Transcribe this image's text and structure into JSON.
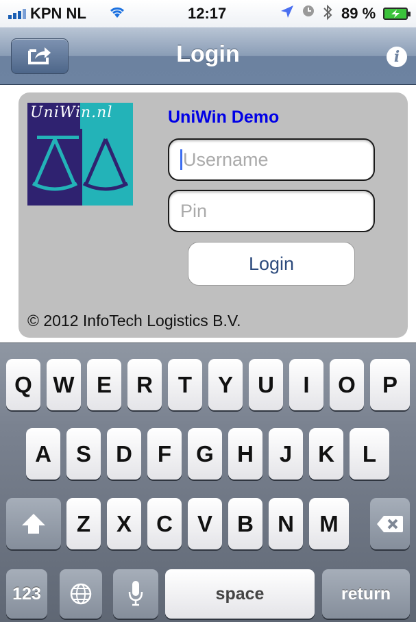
{
  "status_bar": {
    "carrier": "KPN NL",
    "time": "12:17",
    "battery": "89 %"
  },
  "nav_bar": {
    "title": "Login",
    "info_label": "i"
  },
  "login_panel": {
    "logo_text": "UniWin.nl",
    "app_title": "UniWin Demo",
    "username_placeholder": "Username",
    "pin_placeholder": "Pin",
    "login_label": "Login",
    "copyright": "© 2012 InfoTech Logistics B.V."
  },
  "keyboard": {
    "row1": [
      "Q",
      "W",
      "E",
      "R",
      "T",
      "Y",
      "U",
      "I",
      "O",
      "P"
    ],
    "row2": [
      "A",
      "S",
      "D",
      "F",
      "G",
      "H",
      "J",
      "K",
      "L"
    ],
    "row3": [
      "Z",
      "X",
      "C",
      "V",
      "B",
      "N",
      "M"
    ],
    "numbers_label": "123",
    "space_label": "space",
    "return_label": "return"
  },
  "colors": {
    "nav_bar": "#8a9db6",
    "panel": "#bfbfbf",
    "app_title": "#0000e6",
    "logo_purple": "#2f2270",
    "logo_teal": "#23b3b8"
  },
  "icons": [
    "signal-bars-icon",
    "wifi-icon",
    "location-arrow-icon",
    "clock-icon",
    "bluetooth-icon",
    "battery-charging-icon",
    "share-icon",
    "info-icon",
    "shift-icon",
    "backspace-icon",
    "globe-icon",
    "microphone-icon"
  ]
}
